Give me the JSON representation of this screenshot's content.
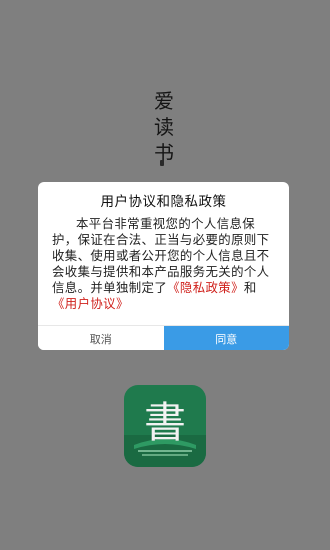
{
  "app": {
    "title_chars": [
      "爱",
      "读",
      "书"
    ]
  },
  "privacy_dialog": {
    "title": "用户协议和隐私政策",
    "body_text": "本平台非常重视您的个人信息保护，保证在合法、正当与必要的原则下收集、使用或者公开您的个人信息且不会收集与提供和本产品服务无关的个人信息。并单独制定了",
    "privacy_policy_link": "《隐私政策》",
    "connector": "和",
    "user_agreement_link": "《用户协议》",
    "cancel_label": "取消",
    "agree_label": "同意"
  },
  "logo": {
    "glyph": "書",
    "icon": "book-logo-icon"
  },
  "colors": {
    "overlay": "#7f7f7f",
    "link": "#d0221d",
    "agree_button": "#3a9be6",
    "logo_green": "#1f7a4d"
  }
}
